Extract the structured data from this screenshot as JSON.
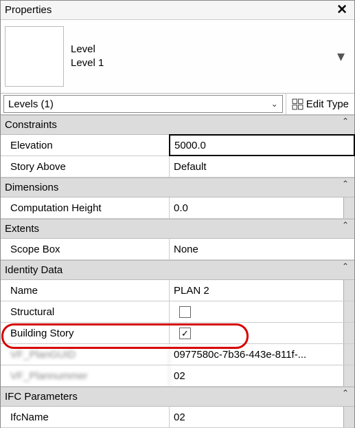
{
  "panel": {
    "title": "Properties"
  },
  "type_selector": {
    "category": "Level",
    "type": "Level 1"
  },
  "instance": {
    "label": "Levels (1)",
    "edit_type": "Edit Type"
  },
  "groups": {
    "constraints": {
      "heading": "Constraints",
      "elevation_label": "Elevation",
      "elevation_value": "5000.0",
      "story_above_label": "Story Above",
      "story_above_value": "Default"
    },
    "dimensions": {
      "heading": "Dimensions",
      "comp_height_label": "Computation Height",
      "comp_height_value": "0.0"
    },
    "extents": {
      "heading": "Extents",
      "scope_box_label": "Scope Box",
      "scope_box_value": "None"
    },
    "identity": {
      "heading": "Identity Data",
      "name_label": "Name",
      "name_value": "PLAN 2",
      "structural_label": "Structural",
      "structural_checked": false,
      "building_story_label": "Building Story",
      "building_story_checked": true,
      "hidden1_label": "VF_PlanGUID",
      "hidden1_value": "0977580c-7b36-443e-811f-...",
      "hidden2_label": "VF_Plannummer",
      "hidden2_value": "02"
    },
    "ifc": {
      "heading": "IFC Parameters",
      "ifcname_label": "IfcName",
      "ifcname_value": "02"
    }
  }
}
